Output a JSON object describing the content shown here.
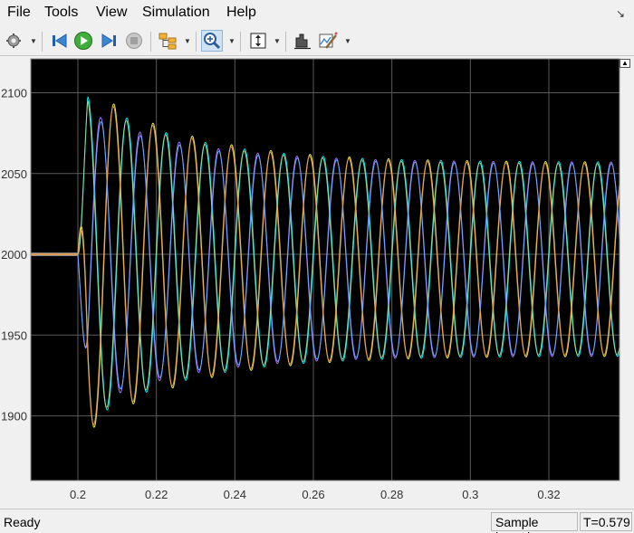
{
  "menubar": {
    "items": [
      "File",
      "Tools",
      "View",
      "Simulation",
      "Help"
    ]
  },
  "toolbar": {
    "icons": [
      "gear-icon",
      "step-back-icon",
      "run-icon",
      "step-forward-icon",
      "stop-icon",
      "signal-hierarchy-icon",
      "zoom-in-icon",
      "fit-axes-icon",
      "cursor-measure-icon",
      "style-edit-icon"
    ]
  },
  "status": {
    "ready": "Ready",
    "mode": "Sample based",
    "time": "T=0.579"
  },
  "colors": {
    "plot_background": "#000000",
    "axes_background": "#f0f0f0",
    "grid": "#5a5a5a",
    "tick_label": "#333333",
    "series": [
      "#00e5e5",
      "#e8e84a",
      "#9f70ff",
      "#9cd69c",
      "#6aa8ff",
      "#e09a52"
    ]
  },
  "chart_data": {
    "type": "line",
    "title": "",
    "xlabel": "",
    "ylabel": "",
    "xlim": [
      0.188,
      0.338
    ],
    "ylim": [
      1860,
      2121
    ],
    "x_ticks": [
      0.2,
      0.22,
      0.24,
      0.26,
      0.28,
      0.3,
      0.32
    ],
    "y_ticks": [
      1900,
      1950,
      2000,
      2050,
      2100
    ],
    "x_tick_labels": [
      "0.2",
      "0.22",
      "0.24",
      "0.26",
      "0.28",
      "0.3",
      "0.32"
    ],
    "y_tick_labels": [
      "1900",
      "1950",
      "2000",
      "2050",
      "2100"
    ],
    "grid": true,
    "series": [
      {
        "baseline": 2000,
        "step_time": 0.2,
        "oscillation_center": 1997,
        "frequency_hz": 100,
        "phase_deg": 0,
        "initial_amplitude": 105,
        "settled_amplitude": 60,
        "color": "#00e5e5"
      },
      {
        "baseline": 2000,
        "step_time": 0.2,
        "oscillation_center": 1997,
        "frequency_hz": 100,
        "phase_deg": 120,
        "initial_amplitude": 112,
        "settled_amplitude": 60,
        "color": "#e8e84a"
      },
      {
        "baseline": 2000,
        "step_time": 0.2,
        "oscillation_center": 1997,
        "frequency_hz": 100,
        "phase_deg": 240,
        "initial_amplitude": 95,
        "settled_amplitude": 60,
        "color": "#9f70ff"
      },
      {
        "baseline": 2000,
        "step_time": 0.2,
        "oscillation_center": 1997,
        "frequency_hz": 100,
        "phase_deg": 5,
        "initial_amplitude": 103,
        "settled_amplitude": 59,
        "color": "#9cd69c"
      },
      {
        "baseline": 2000,
        "step_time": 0.2,
        "oscillation_center": 1997,
        "frequency_hz": 100,
        "phase_deg": 237,
        "initial_amplitude": 92,
        "settled_amplitude": 59,
        "color": "#6aa8ff"
      },
      {
        "baseline": 2000,
        "step_time": 0.2,
        "oscillation_center": 1997,
        "frequency_hz": 100,
        "phase_deg": 124,
        "initial_amplitude": 110,
        "settled_amplitude": 59,
        "color": "#e09a52"
      }
    ]
  }
}
